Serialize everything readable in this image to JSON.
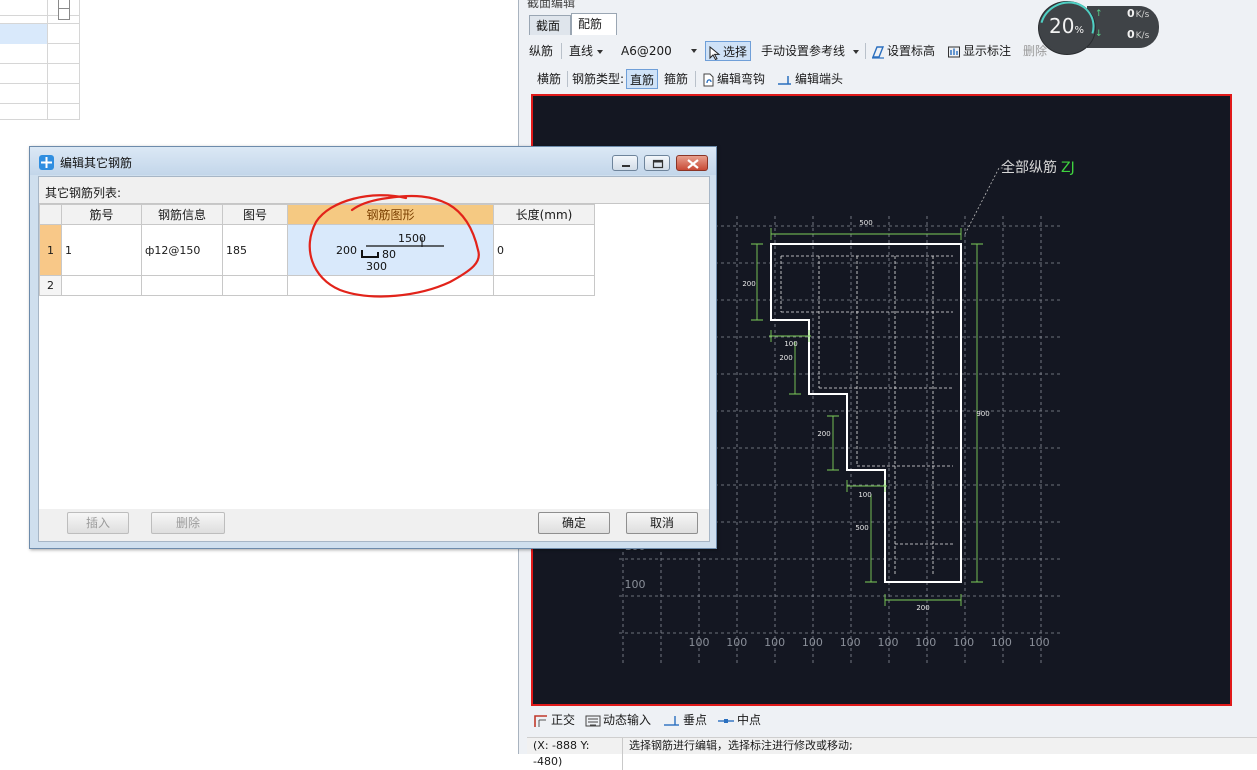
{
  "panel": {
    "title": "截面编辑",
    "tabs": [
      {
        "label": "截面"
      },
      {
        "label": "配筋"
      }
    ],
    "toolbar1": {
      "longitudinal": "纵筋",
      "line_type": "直线",
      "rebar_spec": "A6@200",
      "select": "选择",
      "manual_ref": "手动设置参考线",
      "set_elevation": "设置标高",
      "show_label": "显示标注",
      "delete": "删除"
    },
    "toolbar2": {
      "transverse": "横筋",
      "rebar_type_label": "钢筋类型:",
      "straight": "直筋",
      "stirrup": "箍筋",
      "edit_hook": "编辑弯钩",
      "edit_end": "编辑端头"
    },
    "canvas": {
      "annotation": "全部纵筋",
      "annotation_code": "ZJ",
      "dims": {
        "top": "500",
        "left_top": "200",
        "step1_w": "100",
        "step1_h": "200",
        "step2_h": "200",
        "step2_w": "100",
        "step3_h": "500",
        "right": "900",
        "bottom": "200"
      },
      "grid_label": "100",
      "colors": {
        "background": "#141722",
        "shape": "#ffffff",
        "dimension": "#7ecf5a",
        "grid": "#8a8f99"
      }
    },
    "bottom": {
      "ortho": "正交",
      "dynamic": "动态输入",
      "perp": "垂点",
      "mid": "中点"
    },
    "status": {
      "coord": "(X: -888 Y: -480)",
      "hint": "选择钢筋进行编辑，选择标注进行修改或移动;"
    }
  },
  "speed": {
    "percent": "20",
    "percent_unit": "%",
    "up_value": "0",
    "down_value": "0",
    "unit": "K/s"
  },
  "dialog": {
    "title": "编辑其它钢筋",
    "list_label": "其它钢筋列表:",
    "columns": [
      "筋号",
      "钢筋信息",
      "图号",
      "钢筋图形",
      "长度(mm)"
    ],
    "rows": [
      {
        "num": "1",
        "bar_no": "1",
        "info": "ф12@150",
        "fig": "185",
        "length": "0",
        "shape": {
          "top": "1500",
          "left": "200",
          "hook": "80",
          "bottom": "300"
        }
      },
      {
        "num": "2",
        "bar_no": "",
        "info": "",
        "fig": "",
        "length": ""
      }
    ],
    "buttons": {
      "insert": "插入",
      "delete": "删除",
      "ok": "确定",
      "cancel": "取消"
    }
  }
}
